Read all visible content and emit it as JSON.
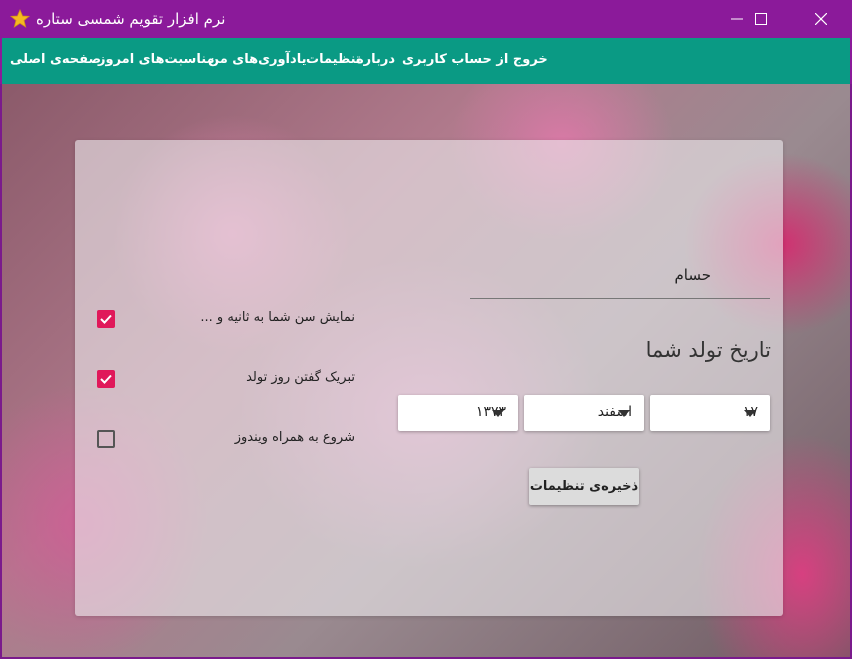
{
  "window": {
    "title": "نرم افزار تقویم شمسی ستاره",
    "icon": "star-icon"
  },
  "menu": {
    "items": [
      {
        "label": "خروج از حساب کاربری"
      },
      {
        "label": "درباره"
      },
      {
        "label": "تنظیمات"
      },
      {
        "label": "یادآوری‌های من"
      },
      {
        "label": "مناسبت‌های امروز"
      },
      {
        "label": "صفحه‌ی اصلی"
      }
    ]
  },
  "settings": {
    "name_value": "حسام",
    "birth_title": "تاریخ تولد شما",
    "birth_day": "۱۷",
    "birth_month": "اسفند",
    "birth_year": "۱۳۷۳",
    "save_label": "ذخیره‌ی تنظیمات",
    "options": [
      {
        "label": "نمایش سن شما به ثانیه و ...",
        "checked": true
      },
      {
        "label": "تبریک گفتن روز تولد",
        "checked": true
      },
      {
        "label": "شروع به همراه ویندوز",
        "checked": false
      }
    ]
  },
  "colors": {
    "titlebar": "#8b1a9a",
    "menubar": "#0a9a84",
    "checkbox_accent": "#e0185a"
  }
}
